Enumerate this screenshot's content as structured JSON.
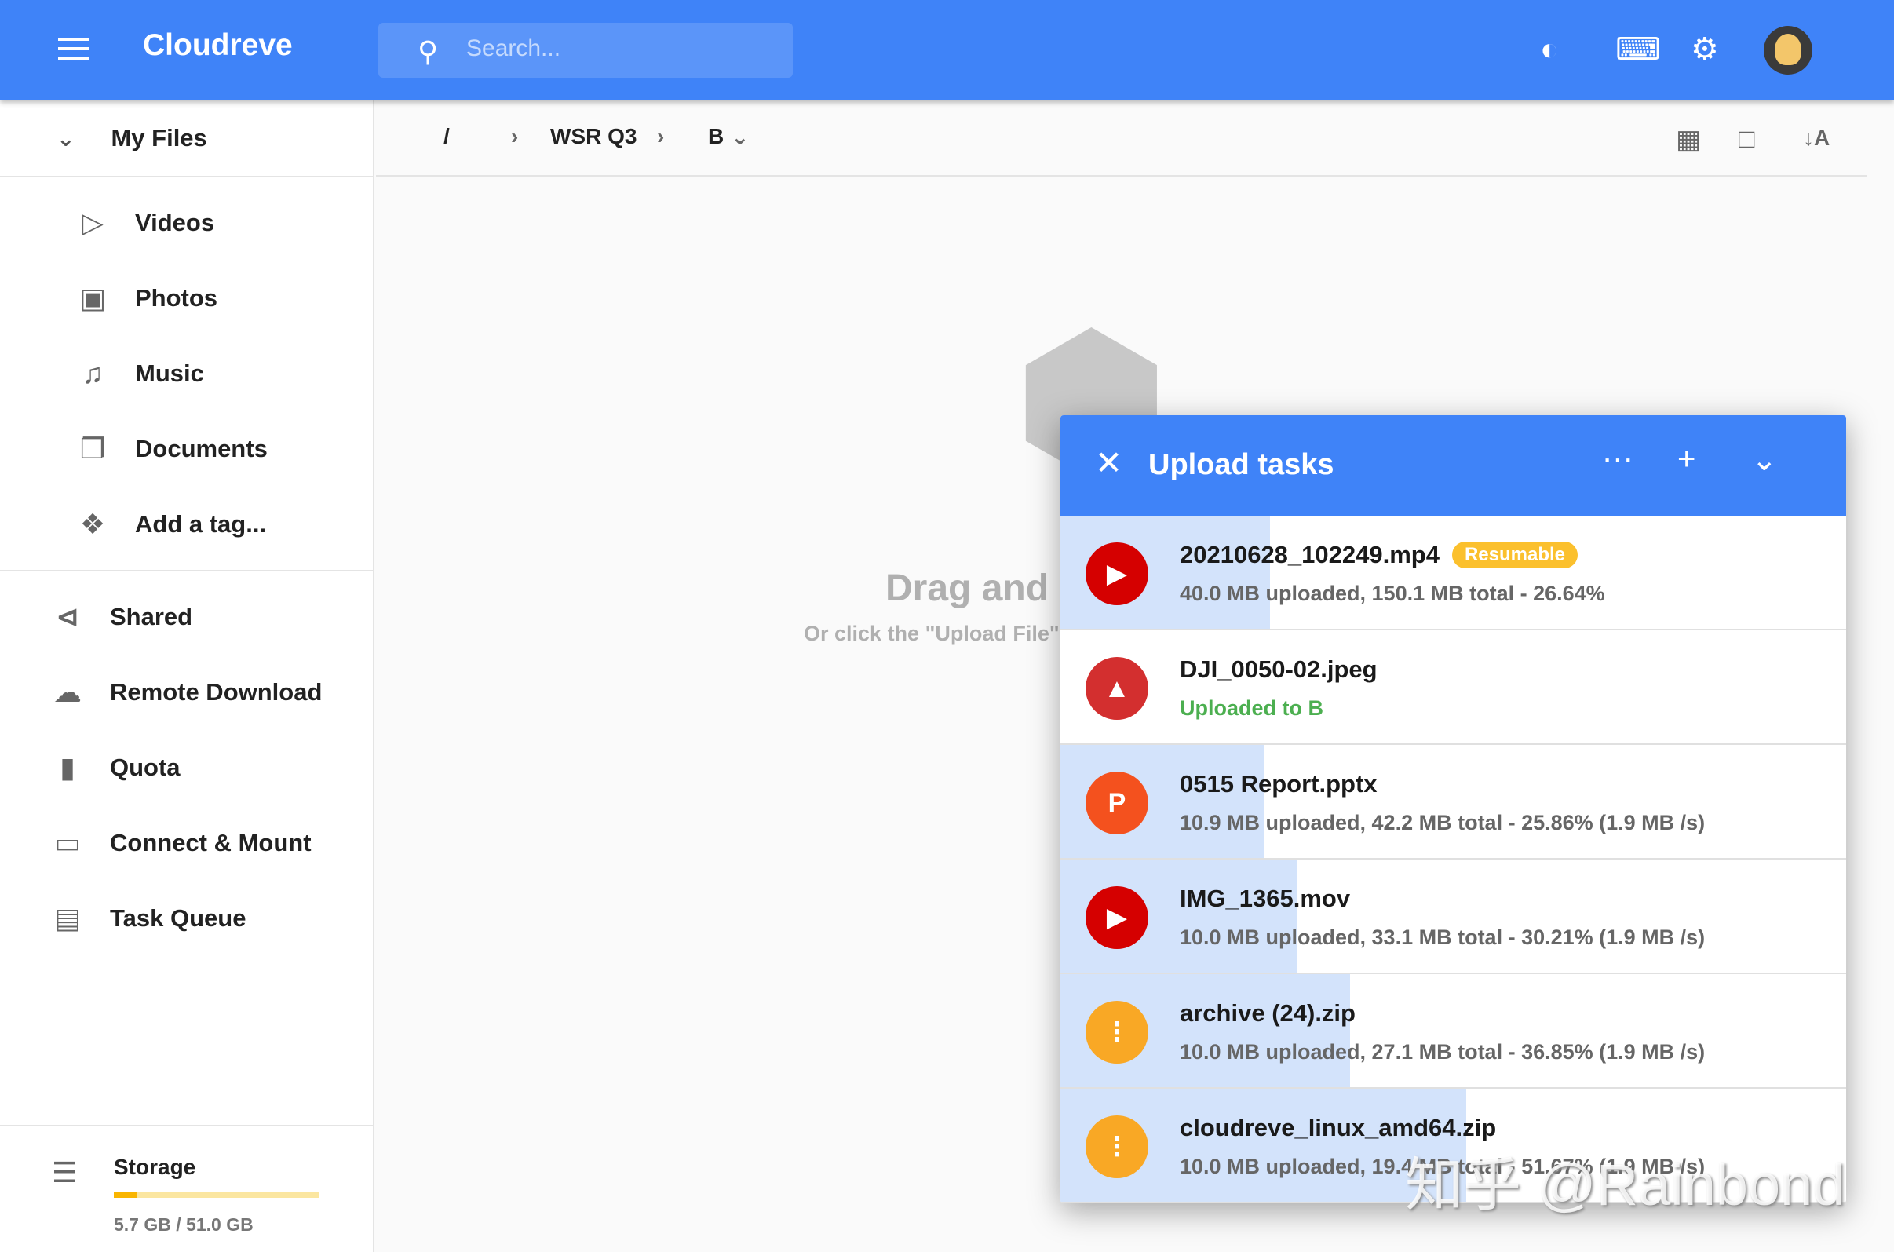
{
  "app": {
    "title": "Cloudreve",
    "search_placeholder": "Search..."
  },
  "header_icons": [
    "theme-icon",
    "keyboard-icon",
    "settings-icon",
    "avatar"
  ],
  "sidebar": {
    "my_files": "My Files",
    "sub_items": [
      {
        "label": "Videos",
        "icon": "video-library-icon"
      },
      {
        "label": "Photos",
        "icon": "photo-library-icon"
      },
      {
        "label": "Music",
        "icon": "music-library-icon"
      },
      {
        "label": "Documents",
        "icon": "documents-icon"
      },
      {
        "label": "Add a tag...",
        "icon": "tag-add-icon"
      }
    ],
    "items": [
      {
        "label": "Shared",
        "icon": "share-icon"
      },
      {
        "label": "Remote Download",
        "icon": "cloud-download-icon"
      },
      {
        "label": "Quota",
        "icon": "sd-card-icon"
      },
      {
        "label": "Connect & Mount",
        "icon": "devices-icon"
      },
      {
        "label": "Task Queue",
        "icon": "clipboard-icon"
      }
    ],
    "storage": {
      "label": "Storage",
      "usage": "5.7 GB / 51.0 GB",
      "used_fraction": 0.112
    }
  },
  "breadcrumb": {
    "root": "/",
    "items": [
      "WSR Q3",
      "B"
    ]
  },
  "empty": {
    "title": "Drag and drop files here",
    "subtitle": "Or click the \"Upload File\" button"
  },
  "upload": {
    "title": "Upload tasks",
    "tasks": [
      {
        "name": "20210628_102249.mp4",
        "badge": "Resumable",
        "status": "40.0 MB uploaded, 150.1 MB total - 26.64%",
        "progress": 26.64,
        "type": "video",
        "color": "#d50000"
      },
      {
        "name": "DJI_0050-02.jpeg",
        "status": "Uploaded to B",
        "done": true,
        "progress": 0,
        "type": "image",
        "color": "#d32f2f"
      },
      {
        "name": "0515 Report.pptx",
        "status": "10.9 MB uploaded, 42.2 MB total - 25.86% (1.9 MB /s)",
        "progress": 25.86,
        "type": "ppt",
        "color": "#f4511e"
      },
      {
        "name": "IMG_1365.mov",
        "status": "10.0 MB uploaded, 33.1 MB total - 30.21% (1.9 MB /s)",
        "progress": 30.21,
        "type": "video",
        "color": "#d50000"
      },
      {
        "name": "archive (24).zip",
        "status": "10.0 MB uploaded, 27.1 MB total - 36.85% (1.9 MB /s)",
        "progress": 36.85,
        "type": "zip",
        "color": "#f9a825"
      },
      {
        "name": "cloudreve_linux_amd64.zip",
        "status": "10.0 MB uploaded, 19.4 MB total - 51.67% (1.9 MB /s)",
        "progress": 51.67,
        "type": "zip",
        "color": "#f9a825"
      }
    ]
  },
  "watermark": "知乎 @Rainbond"
}
